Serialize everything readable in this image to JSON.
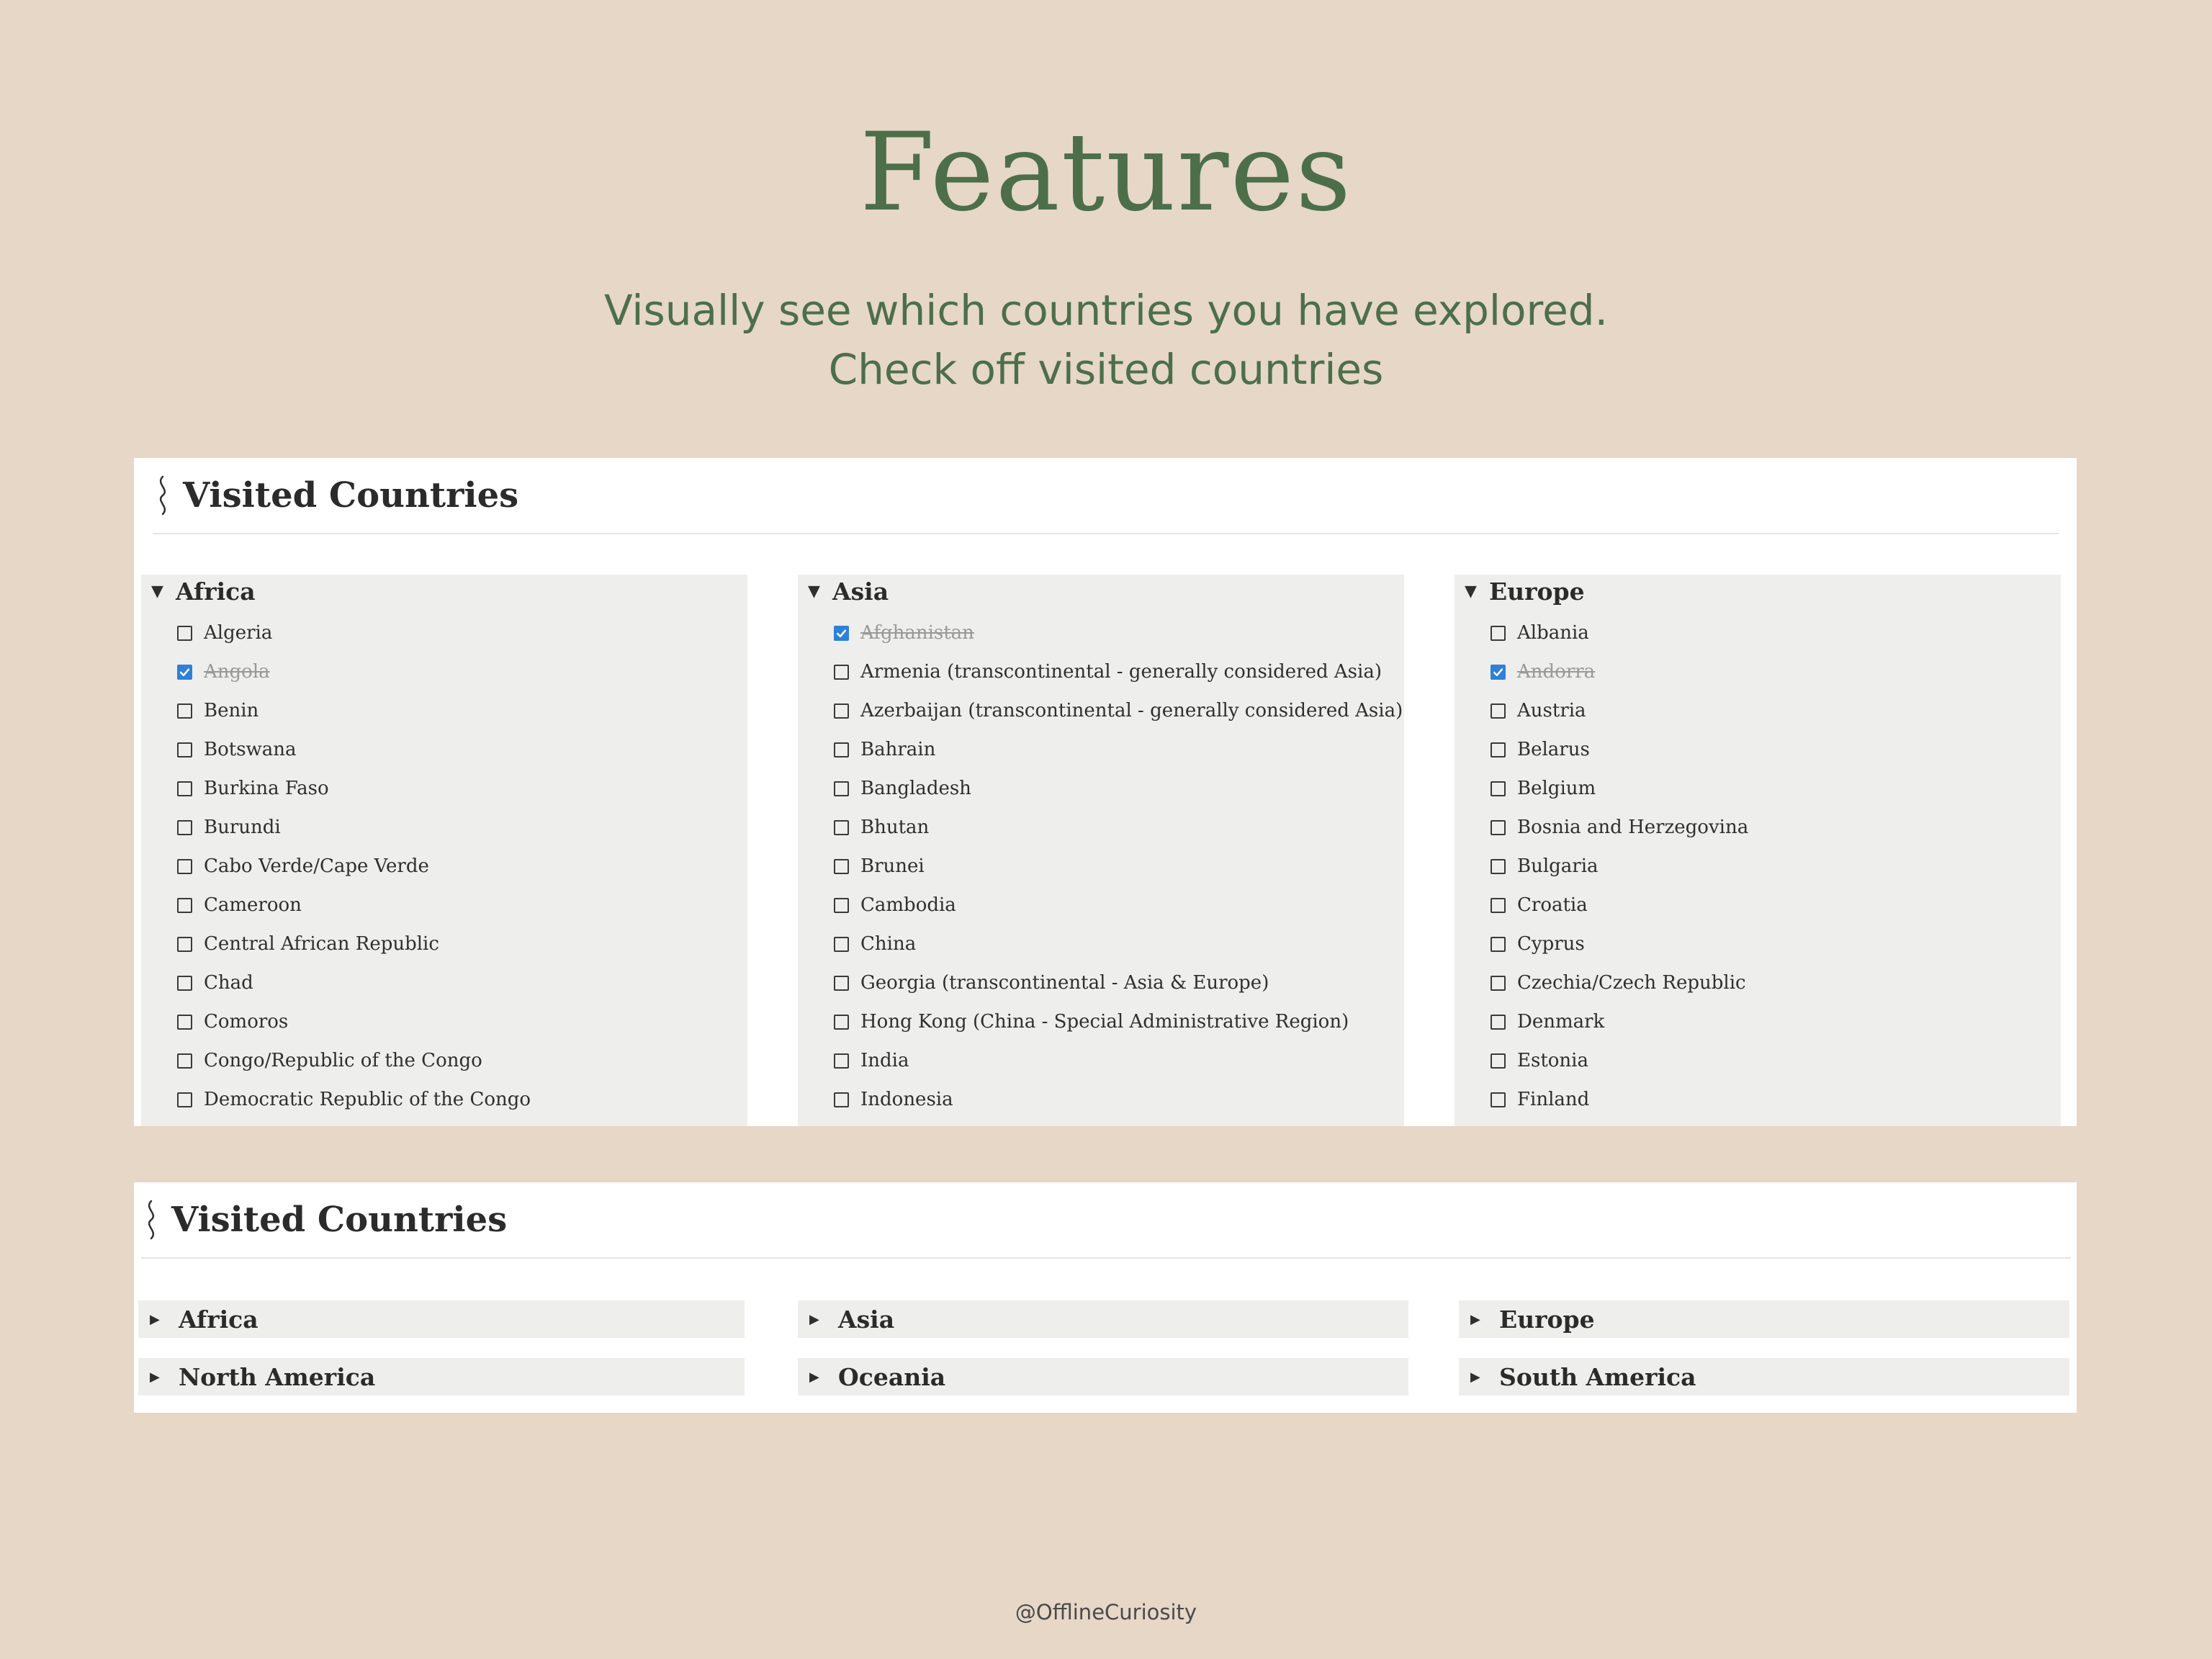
{
  "title": "Features",
  "subtitle_line1": "Visually see which countries you have explored.",
  "subtitle_line2": "Check off visited countries",
  "panel1": {
    "heading": "Visited Countries",
    "groups": [
      {
        "name": "Africa",
        "items": [
          {
            "label": "Algeria",
            "checked": false
          },
          {
            "label": "Angola",
            "checked": true
          },
          {
            "label": "Benin",
            "checked": false
          },
          {
            "label": "Botswana",
            "checked": false
          },
          {
            "label": "Burkina Faso",
            "checked": false
          },
          {
            "label": "Burundi",
            "checked": false
          },
          {
            "label": "Cabo Verde/Cape Verde",
            "checked": false
          },
          {
            "label": "Cameroon",
            "checked": false
          },
          {
            "label": "Central African Republic",
            "checked": false
          },
          {
            "label": "Chad",
            "checked": false
          },
          {
            "label": "Comoros",
            "checked": false
          },
          {
            "label": "Congo/Republic of the Congo",
            "checked": false
          },
          {
            "label": "Democratic Republic of the Congo",
            "checked": false
          }
        ]
      },
      {
        "name": "Asia",
        "items": [
          {
            "label": "Afghanistan",
            "checked": true
          },
          {
            "label": "Armenia (transcontinental - generally considered Asia)",
            "checked": false
          },
          {
            "label": "Azerbaijan (transcontinental - generally considered Asia)",
            "checked": false
          },
          {
            "label": "Bahrain",
            "checked": false
          },
          {
            "label": "Bangladesh",
            "checked": false
          },
          {
            "label": "Bhutan",
            "checked": false
          },
          {
            "label": "Brunei",
            "checked": false
          },
          {
            "label": "Cambodia",
            "checked": false
          },
          {
            "label": "China",
            "checked": false
          },
          {
            "label": "Georgia (transcontinental - Asia & Europe)",
            "checked": false
          },
          {
            "label": "Hong Kong (China - Special Administrative Region)",
            "checked": false
          },
          {
            "label": "India",
            "checked": false
          },
          {
            "label": "Indonesia",
            "checked": false
          }
        ]
      },
      {
        "name": "Europe",
        "items": [
          {
            "label": "Albania",
            "checked": false
          },
          {
            "label": "Andorra",
            "checked": true
          },
          {
            "label": "Austria",
            "checked": false
          },
          {
            "label": "Belarus",
            "checked": false
          },
          {
            "label": "Belgium",
            "checked": false
          },
          {
            "label": "Bosnia and Herzegovina",
            "checked": false
          },
          {
            "label": "Bulgaria",
            "checked": false
          },
          {
            "label": "Croatia",
            "checked": false
          },
          {
            "label": "Cyprus",
            "checked": false
          },
          {
            "label": "Czechia/Czech Republic",
            "checked": false
          },
          {
            "label": "Denmark",
            "checked": false
          },
          {
            "label": "Estonia",
            "checked": false
          },
          {
            "label": "Finland",
            "checked": false
          }
        ]
      }
    ]
  },
  "panel2": {
    "heading": "Visited Countries",
    "toggles": [
      "Africa",
      "Asia",
      "Europe",
      "North America",
      "Oceania",
      "South America"
    ]
  },
  "footer": "@OfflineCuriosity",
  "colors": {
    "background": "#e6d7c7",
    "accent_green": "#4c6f4a",
    "checkbox_blue": "#2f80d8",
    "column_bg": "#eeeeec"
  },
  "icons": {
    "header_icon": "squiggle-icon",
    "expanded": "triangle-down-icon",
    "collapsed": "triangle-right-icon",
    "check": "checkmark-icon"
  }
}
